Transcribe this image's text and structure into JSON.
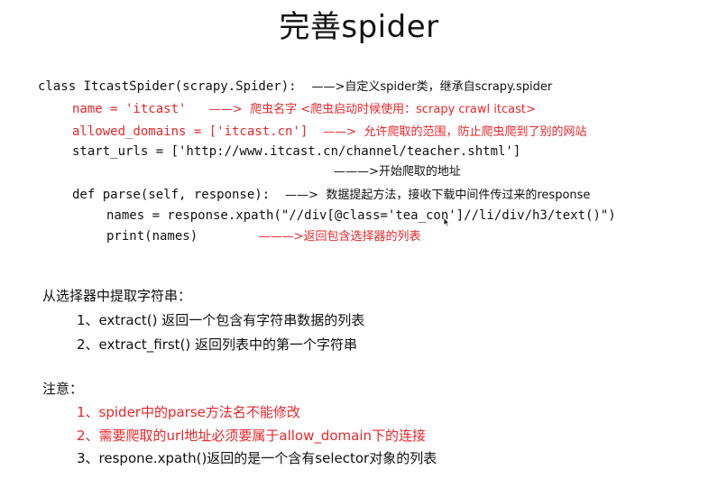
{
  "title": "完善spider",
  "code": {
    "class_line": {
      "code": "class ItcastSpider(scrapy.Spider):",
      "arrow": "——>",
      "note": "自定义spider类，继承自scrapy.spider"
    },
    "name_line": {
      "code": "name = 'itcast'",
      "arrow": "——>",
      "note": "爬虫名字 <爬虫启动时候使用：scrapy crawl itcast>"
    },
    "allowed_line": {
      "code": "allowed_domains = ['itcast.cn']",
      "arrow": "——>",
      "note": "允许爬取的范围，防止爬虫爬到了别的网站"
    },
    "start_urls_line": {
      "code": "start_urls = ['http://www.itcast.cn/channel/teacher.shtml']"
    },
    "start_urls_note_line": {
      "arrow": "———>",
      "note": "开始爬取的地址"
    },
    "parse_line": {
      "code": "def parse(self, response):",
      "arrow": "——>",
      "note": "数据提起方法，接收下载中间件传过来的response"
    },
    "names_line": {
      "code": "names = response.xpath(\"//div[@class='tea_con']//li/div/h3/text()\")"
    },
    "print_line": {
      "code": "print(names)",
      "arrow": "———>",
      "note": "返回包含选择器的列表"
    }
  },
  "extract_section": {
    "heading": "从选择器中提取字符串：",
    "items": [
      "1、extract() 返回一个包含有字符串数据的列表",
      "2、extract_first() 返回列表中的第一个字符串"
    ]
  },
  "notes_section": {
    "heading": "注意：",
    "items": [
      "1、spider中的parse方法名不能修改",
      "2、需要爬取的url地址必须要属于allow_domain下的连接",
      "3、respone.xpath()返回的是一个含有selector对象的列表"
    ]
  },
  "colors": {
    "accent_red": "#e8262a",
    "text": "#111111",
    "background": "#ffffff"
  },
  "icons": {
    "cursor": "mouse-cursor-icon"
  }
}
